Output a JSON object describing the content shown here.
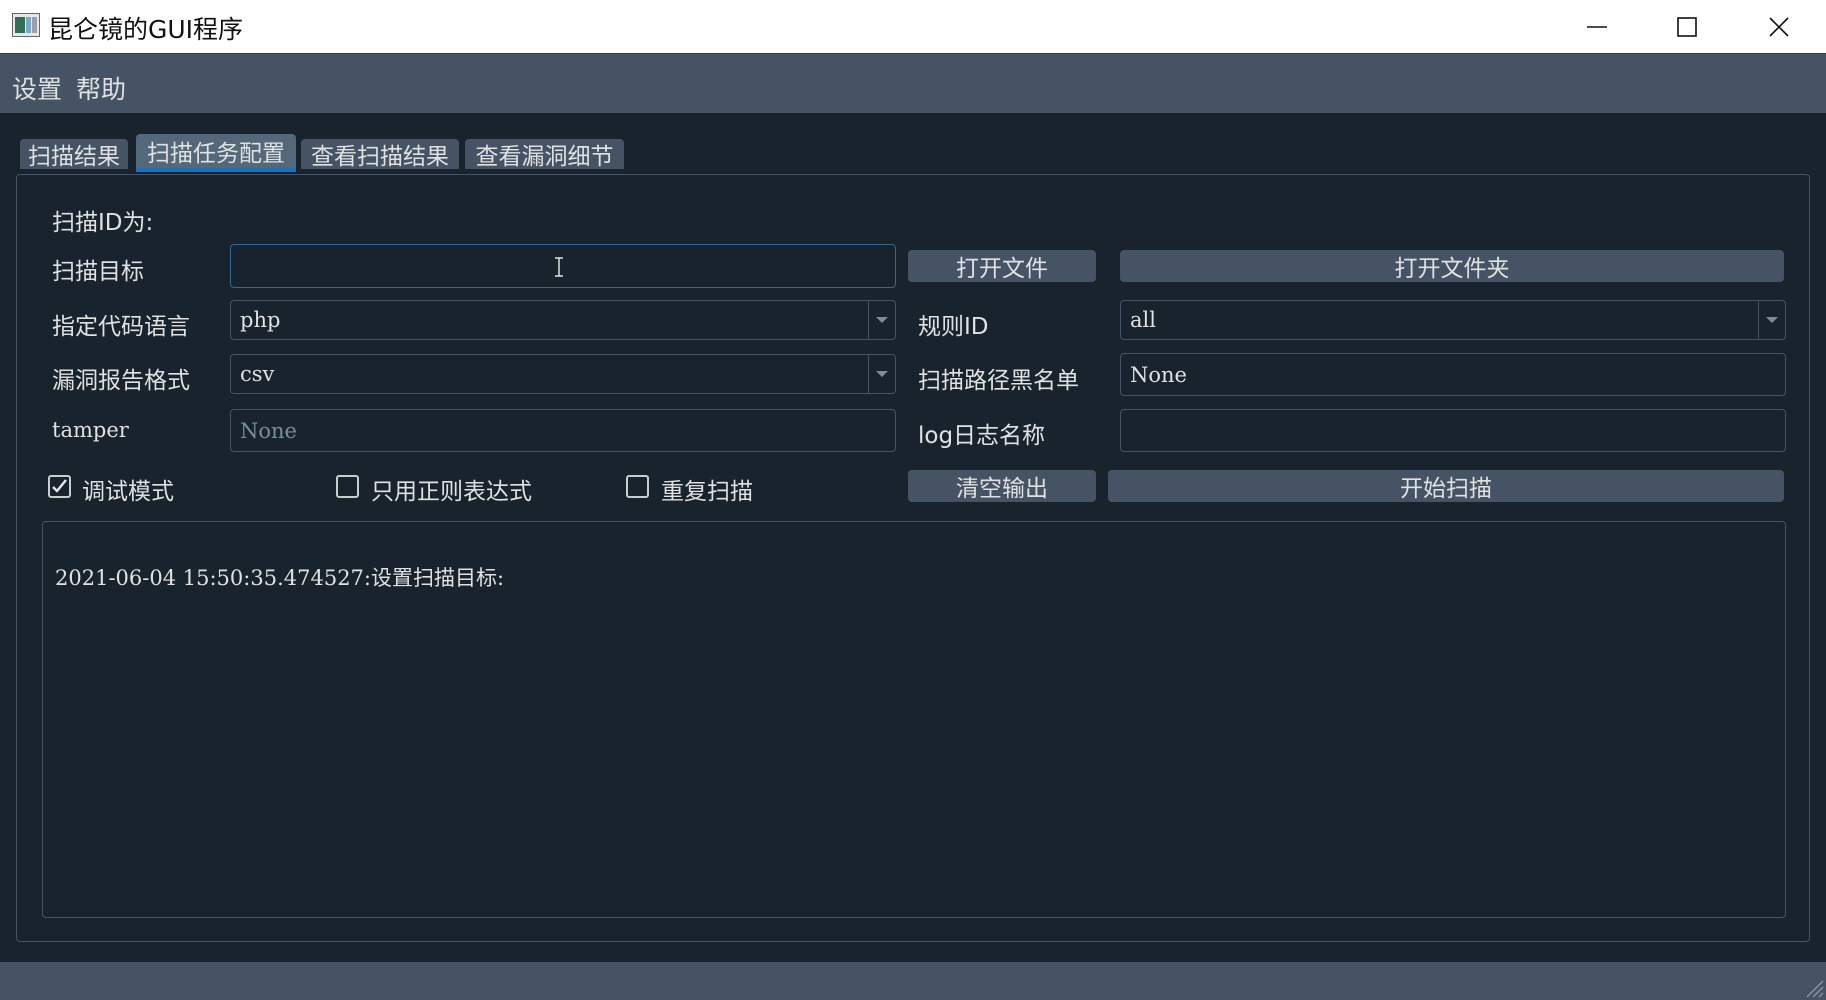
{
  "window": {
    "title": "昆仑镜的GUI程序"
  },
  "menubar": {
    "items": [
      {
        "label": "设置"
      },
      {
        "label": "帮助"
      }
    ]
  },
  "tabs": [
    {
      "label": "扫描结果",
      "active": false
    },
    {
      "label": "扫描任务配置",
      "active": true
    },
    {
      "label": "查看扫描结果",
      "active": false
    },
    {
      "label": "查看漏洞细节",
      "active": false
    }
  ],
  "form": {
    "scan_id_label": "扫描ID为:",
    "scan_target_label": "扫描目标",
    "scan_target_value": "",
    "open_file_button": "打开文件",
    "open_folder_button": "打开文件夹",
    "code_language_label": "指定代码语言",
    "code_language_value": "php",
    "rule_id_label": "规则ID",
    "rule_id_value": "all",
    "report_format_label": "漏洞报告格式",
    "report_format_value": "csv",
    "path_blacklist_label": "扫描路径黑名单",
    "path_blacklist_value": "None",
    "tamper_label": "tamper",
    "tamper_placeholder": "None",
    "log_name_label": "log日志名称",
    "log_name_value": ""
  },
  "options": {
    "debug_mode": {
      "label": "调试模式",
      "checked": true
    },
    "regex_only": {
      "label": "只用正则表达式",
      "checked": false
    },
    "repeat_scan": {
      "label": "重复扫描",
      "checked": false
    }
  },
  "actions": {
    "clear_output": "清空输出",
    "start_scan": "开始扫描"
  },
  "output": {
    "lines": [
      "2021-06-04 15:50:35.474527:设置扫描目标:"
    ]
  },
  "colors": {
    "background": "#19232d",
    "surface": "#455364",
    "text": "#dfe1e2",
    "accent": "#1a72bb"
  }
}
